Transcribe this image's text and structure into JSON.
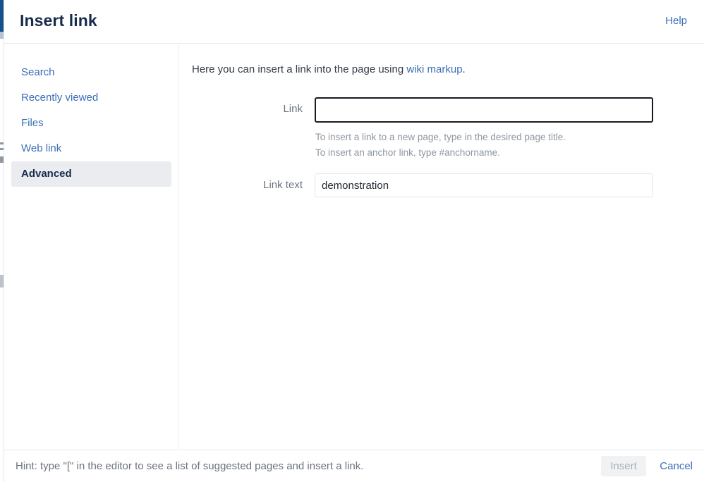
{
  "header": {
    "title": "Insert link",
    "help_label": "Help"
  },
  "sidebar": {
    "items": [
      {
        "label": "Search",
        "selected": false
      },
      {
        "label": "Recently viewed",
        "selected": false
      },
      {
        "label": "Files",
        "selected": false
      },
      {
        "label": "Web link",
        "selected": false
      },
      {
        "label": "Advanced",
        "selected": true
      }
    ]
  },
  "main": {
    "intro_prefix": "Here you can insert a link into the page using ",
    "intro_link": "wiki markup",
    "intro_suffix": ".",
    "fields": {
      "link": {
        "label": "Link",
        "value": "",
        "placeholder": "",
        "focused": true,
        "hints": [
          "To insert a link to a new page, type in the desired page title.",
          "To insert an anchor link, type #anchorname."
        ]
      },
      "link_text": {
        "label": "Link text",
        "value": "demonstration",
        "placeholder": "",
        "focused": false
      }
    }
  },
  "footer": {
    "hint": "Hint: type \"[\" in the editor to see a list of suggested pages and insert a link.",
    "insert_label": "Insert",
    "insert_disabled": true,
    "cancel_label": "Cancel"
  },
  "colors": {
    "accent_link": "#3b6fb6",
    "title_text": "#172b4d",
    "muted_text": "#6b727c",
    "hint_text": "#8e969f",
    "selected_nav_bg": "#ebecf0",
    "focused_border": "#161b22",
    "edge_bar": "#15518c",
    "disabled_button_bg": "#f1f2f4"
  }
}
